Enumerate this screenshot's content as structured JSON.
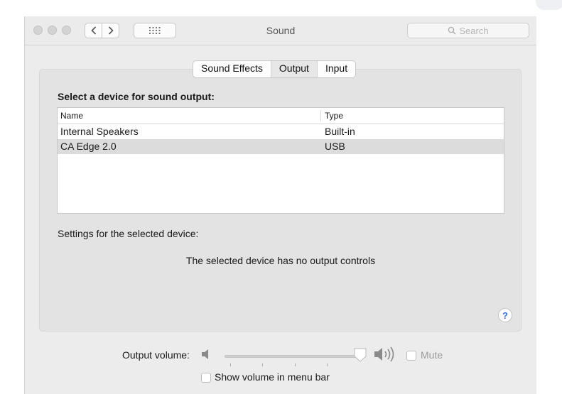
{
  "window": {
    "title": "Sound"
  },
  "search": {
    "placeholder": "Search"
  },
  "tabs": [
    {
      "label": "Sound Effects",
      "active": false
    },
    {
      "label": "Output",
      "active": true
    },
    {
      "label": "Input",
      "active": false
    }
  ],
  "output": {
    "heading": "Select a device for sound output:",
    "columns": {
      "name": "Name",
      "type": "Type"
    },
    "devices": [
      {
        "name": "Internal Speakers",
        "type": "Built-in",
        "selected": false
      },
      {
        "name": "CA Edge 2.0",
        "type": "USB",
        "selected": true
      }
    ],
    "settings_label": "Settings for the selected device:",
    "no_controls_text": "The selected device has no output controls"
  },
  "help": {
    "label": "?"
  },
  "volume": {
    "label": "Output volume:",
    "level": 1.0,
    "mute_label": "Mute",
    "mute_checked": false,
    "show_in_menu_label": "Show volume in menu bar",
    "show_in_menu_checked": false
  },
  "colors": {
    "accent": "#3a6fd8",
    "panel": "#e3e3e3",
    "selected_row": "#dcdcdc"
  },
  "icons": {
    "back": "chevron-left-icon",
    "forward": "chevron-right-icon",
    "grid": "grid-icon",
    "search": "search-icon",
    "volume_low": "speaker-low-icon",
    "volume_high": "speaker-high-icon"
  }
}
